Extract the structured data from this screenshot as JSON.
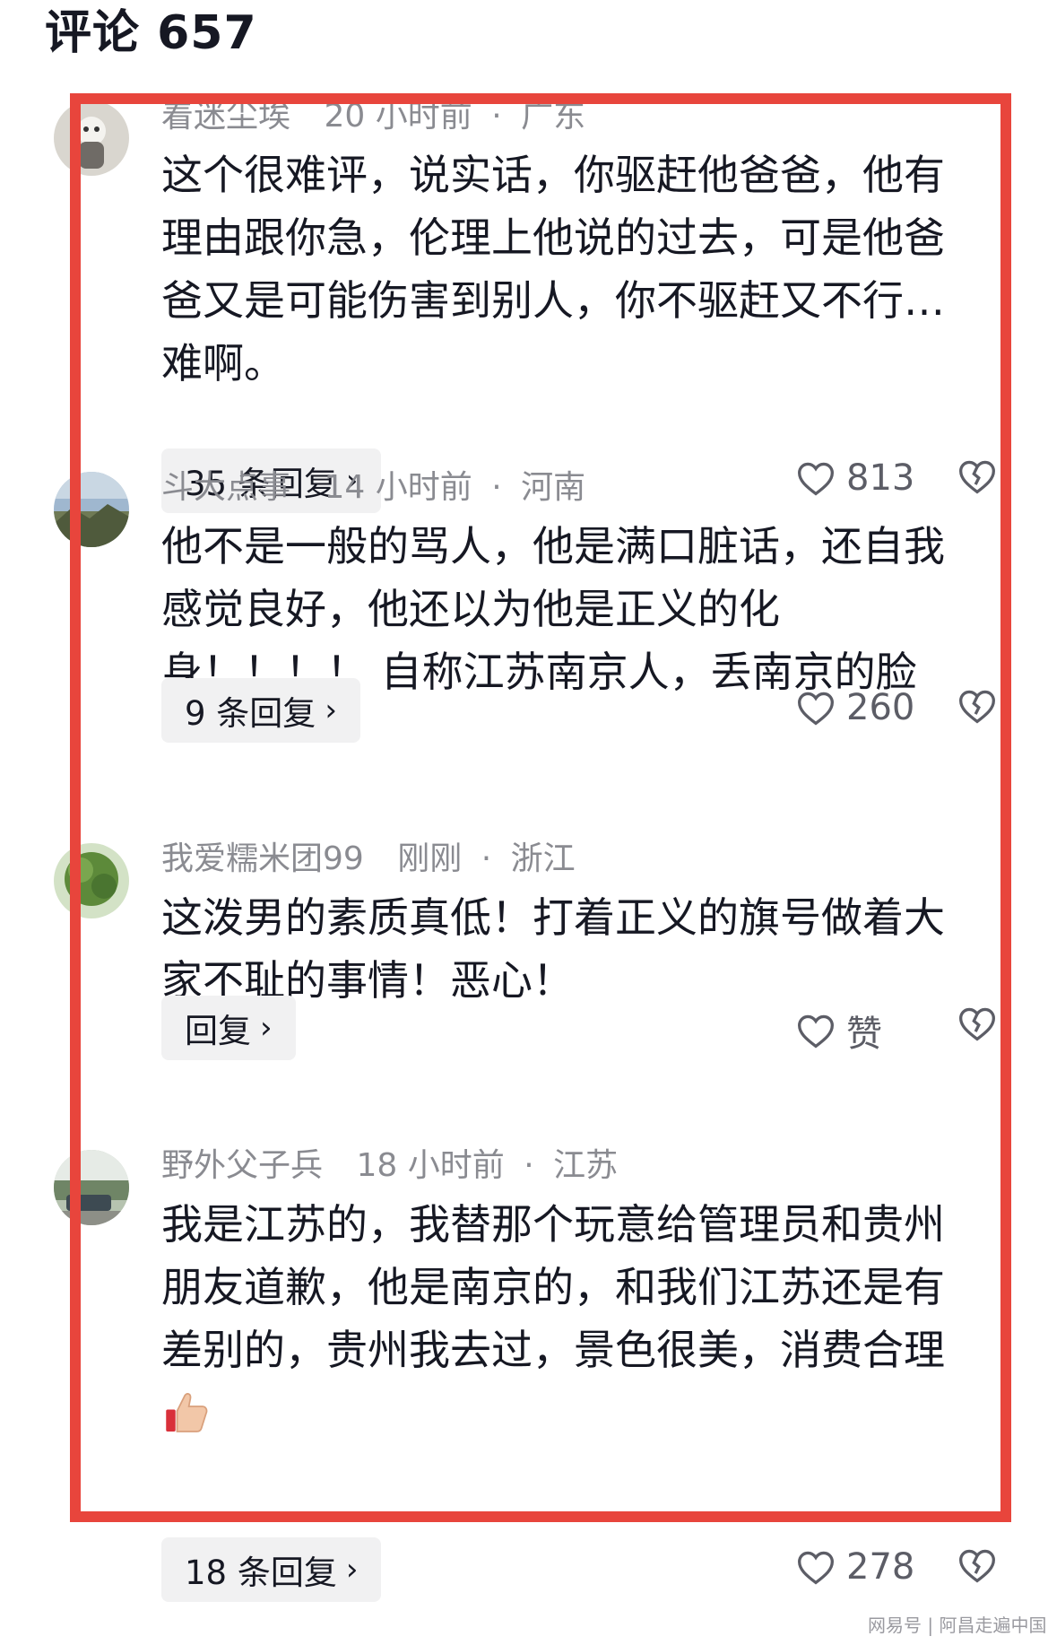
{
  "header": {
    "title": "评论 657"
  },
  "comments": [
    {
      "username": "着迷尘埃",
      "time": "20 小时前",
      "dot": "·",
      "location": "广东",
      "lines": [
        "这个很难评，说实话，你驱赶他爸爸，他有",
        "理由跟你急，伦理上他说的过去，可是他爸",
        "爸又是可能伤害到别人，你不驱赶又不行…",
        "难啊。"
      ],
      "reply_label": "35 条回复",
      "likes": "813"
    },
    {
      "username": "斗大点事",
      "time": "14 小时前",
      "dot": "·",
      "location": "河南",
      "lines": [
        "他不是一般的骂人，他是满口脏话，还自我",
        "感觉良好，他还以为他是正义的化",
        "身！！！！ 自称江苏南京人，丢南京的脸"
      ],
      "reply_label": "9 条回复",
      "likes": "260"
    },
    {
      "username": "我爱糯米团99",
      "time": "刚刚",
      "dot": "·",
      "location": "浙江",
      "lines": [
        "这泼男的素质真低！打着正义的旗号做着大",
        "家不耻的事情！恶心！"
      ],
      "reply_label": "回复",
      "likes": "赞"
    },
    {
      "username": "野外父子兵",
      "time": "18 小时前",
      "dot": "·",
      "location": "江苏",
      "lines": [
        "我是江苏的，我替那个玩意给管理员和贵州",
        "朋友道歉，他是南京的，和我们江苏还是有",
        "差别的，贵州我去过，景色很美，消费合理"
      ],
      "reply_label": "18 条回复",
      "likes": "278"
    }
  ],
  "chevron": "›",
  "watermark": "网易号 | 阿昌走遍中国",
  "colors": {
    "highlight": "#e8453c",
    "meta": "#8a8b91",
    "text": "#161823",
    "reply_bg": "#f1f1f2"
  },
  "icons": [
    "heart-outline-icon",
    "broken-heart-icon",
    "thumbs-up-emoji"
  ]
}
